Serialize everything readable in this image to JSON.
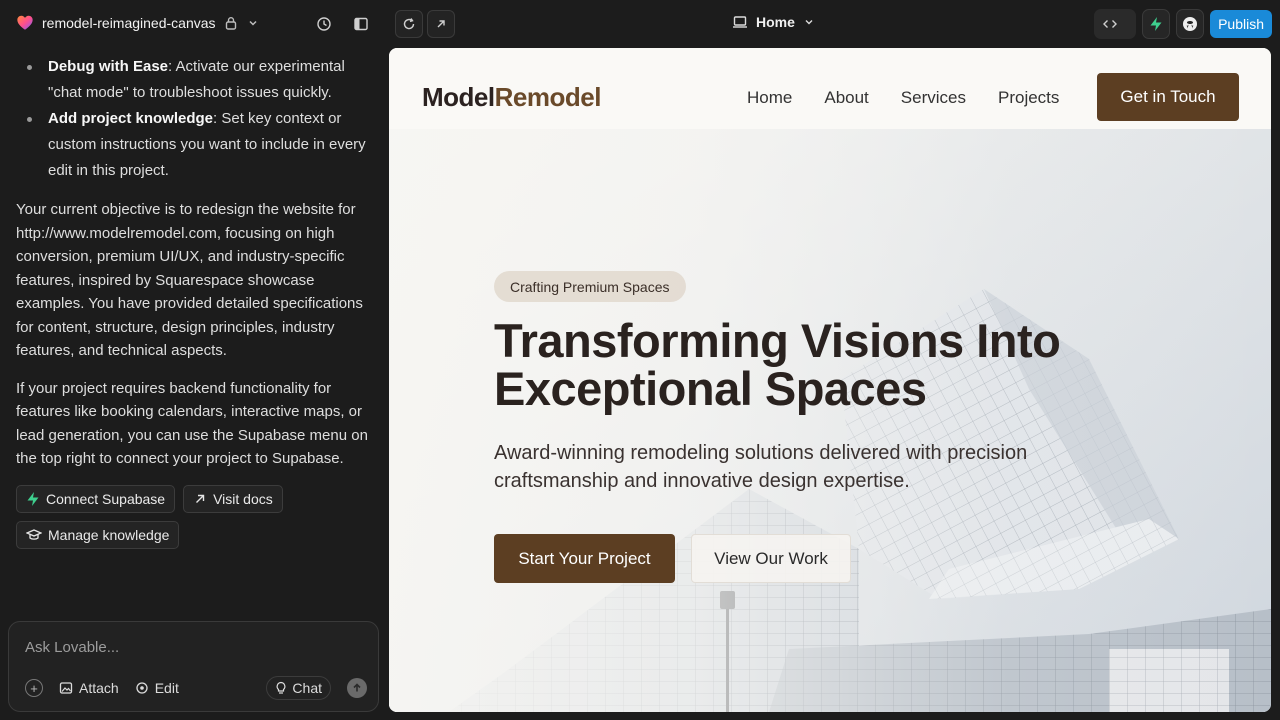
{
  "topbar": {
    "project_name": "remodel-reimagined-canvas",
    "page_selector": "Home",
    "publish_label": "Publish"
  },
  "chat": {
    "bullets": [
      {
        "title": "Debug with Ease",
        "text": ": Activate our experimental \"chat mode\" to troubleshoot issues quickly."
      },
      {
        "title": "Add project knowledge",
        "text": ": Set key context or custom instructions you want to include in every edit in this project."
      }
    ],
    "paragraph1": "Your current objective is to redesign the website for http://www.modelremodel.com, focusing on high conversion, premium UI/UX, and industry-specific features, inspired by Squarespace showcase examples. You have provided detailed specifications for content, structure, design principles, industry features, and technical aspects.",
    "paragraph2": "If your project requires backend functionality for features like booking calendars, interactive maps, or lead generation, you can use the Supabase menu on the top right to connect your project to Supabase.",
    "chips": {
      "connect": "Connect Supabase",
      "docs": "Visit docs",
      "knowledge": "Manage knowledge"
    },
    "input": {
      "placeholder": "Ask Lovable...",
      "attach": "Attach",
      "edit": "Edit",
      "chat": "Chat"
    }
  },
  "site": {
    "logo_a": "Model",
    "logo_b": "Remodel",
    "nav": [
      "Home",
      "About",
      "Services",
      "Projects"
    ],
    "cta": "Get in Touch",
    "hero": {
      "tag": "Crafting Premium Spaces",
      "title": "Transforming Visions Into Exceptional Spaces",
      "subtitle": "Award-winning remodeling solutions delivered with precision craftsmanship and innovative design expertise.",
      "primary": "Start Your Project",
      "secondary": "View Our Work"
    }
  },
  "colors": {
    "brand_brown": "#5c3e22",
    "publish_blue": "#1a8ad8",
    "supabase_green": "#3ecf8e"
  }
}
